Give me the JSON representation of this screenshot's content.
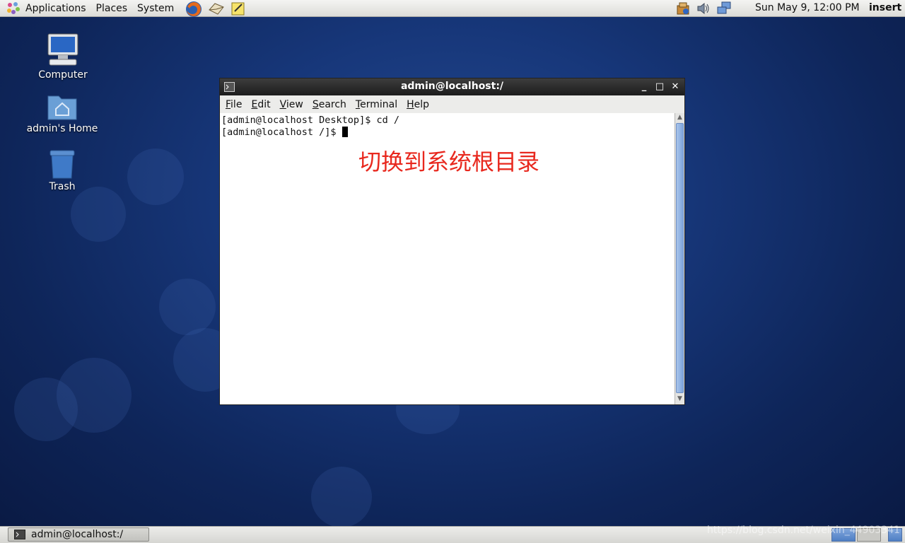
{
  "top_panel": {
    "menus": [
      "Applications",
      "Places",
      "System"
    ],
    "launchers": [
      "firefox-icon",
      "mail-icon",
      "notes-icon"
    ],
    "tray": [
      "updates-icon",
      "volume-icon",
      "network-icon"
    ],
    "clock": "Sun May  9, 12:00 PM",
    "mode": "insert"
  },
  "desktop": {
    "icons": [
      {
        "label": "Computer"
      },
      {
        "label": "admin's Home"
      },
      {
        "label": "Trash"
      }
    ]
  },
  "terminal": {
    "title": "admin@localhost:/",
    "menu": [
      "File",
      "Edit",
      "View",
      "Search",
      "Terminal",
      "Help"
    ],
    "lines": [
      "[admin@localhost Desktop]$ cd /",
      "[admin@localhost /]$ "
    ],
    "annotation": "切换到系统根目录",
    "annotation_color": "#e8281e"
  },
  "taskbar": {
    "task_label": "admin@localhost:/"
  },
  "watermark": "https://blog.csdn.net/weixin_44903341"
}
